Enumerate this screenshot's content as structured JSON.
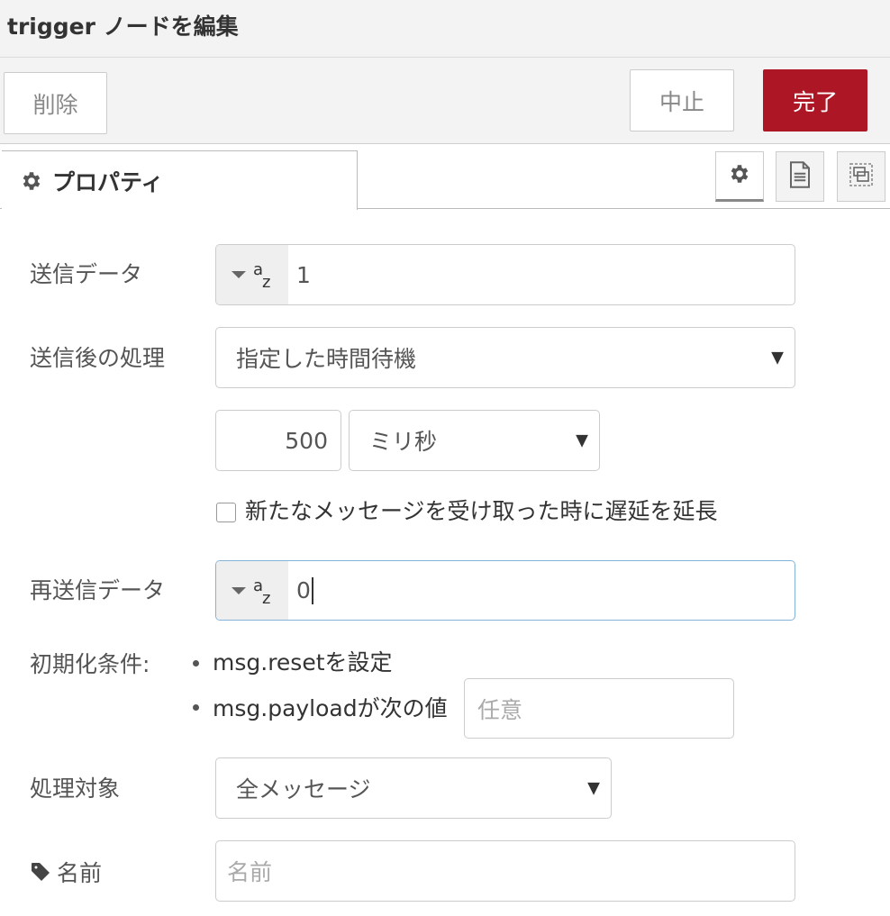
{
  "header": {
    "title": "trigger ノードを編集"
  },
  "toolbar": {
    "delete_label": "削除",
    "cancel_label": "中止",
    "done_label": "完了"
  },
  "tabs": {
    "properties_label": "プロパティ"
  },
  "form": {
    "send": {
      "label": "送信データ",
      "value": "1"
    },
    "then": {
      "label": "送信後の処理",
      "selected": "指定した時間待機"
    },
    "duration": {
      "value": "500",
      "unit": "ミリ秒"
    },
    "extend": {
      "label": "新たなメッセージを受け取った時に遅延を延長",
      "checked": false
    },
    "resend": {
      "label": "再送信データ",
      "value": "0"
    },
    "reset": {
      "label": "初期化条件:",
      "option1": "msg.resetを設定",
      "option2": "msg.payloadが次の値",
      "placeholder": "任意"
    },
    "handling": {
      "label": "処理対象",
      "selected": "全メッセージ"
    },
    "name": {
      "label": "名前",
      "placeholder": "名前"
    }
  },
  "icons": {
    "tab": "gear-icon",
    "side": [
      "gear-icon",
      "document-icon",
      "layout-icon"
    ],
    "name_label": "tag-icon"
  },
  "colors": {
    "primary_button": "#ad1625",
    "focus_border": "#85b2d7"
  }
}
